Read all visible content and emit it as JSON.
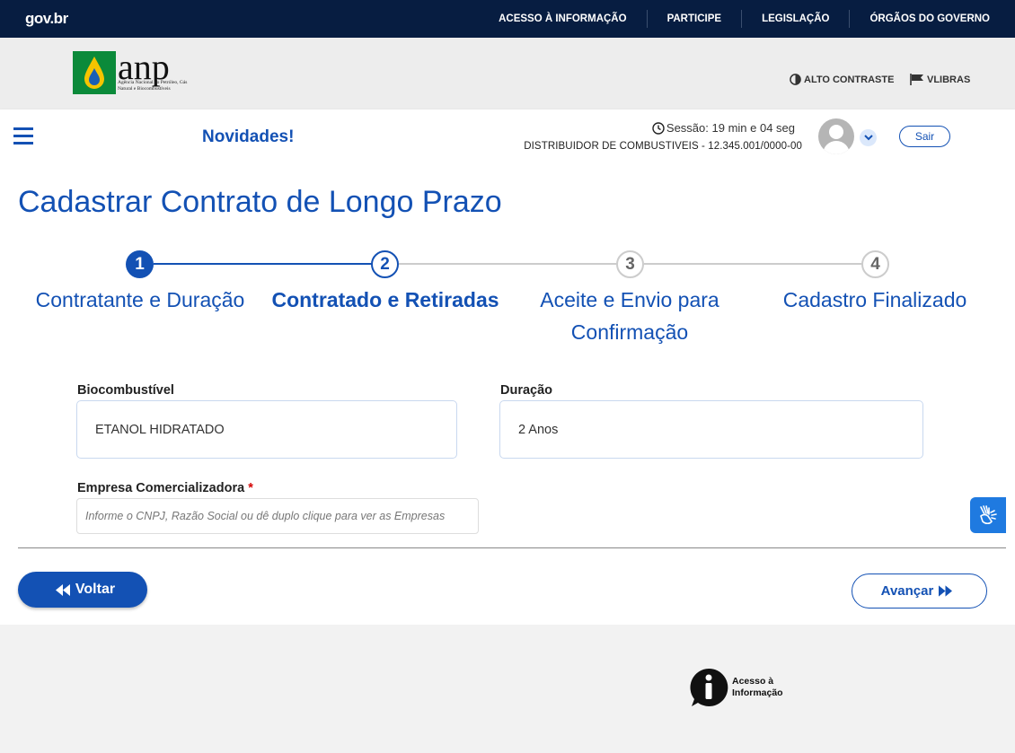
{
  "govbar": {
    "logo": "gov.br",
    "links": [
      "ACESSO À INFORMAÇÃO",
      "PARTICIPE",
      "LEGISLAÇÃO",
      "ÓRGÃOS DO GOVERNO"
    ]
  },
  "header": {
    "logo_word": "anp",
    "logo_sub": "Agência Nacional do Petróleo, Gás Natural e Biocombustíveis",
    "alto_contraste": "ALTO CONTRASTE",
    "vlibras": "VLIBRAS"
  },
  "navbar": {
    "novidades": "Novidades!",
    "sessao": "Sessão: 19 min e 04 seg",
    "distribuidor": "DISTRIBUIDOR DE COMBUSTIVEIS - 12.345.001/0000-00",
    "sair": "Sair"
  },
  "page": {
    "title": "Cadastrar Contrato de Longo Prazo"
  },
  "steps": [
    {
      "number": "1",
      "label": "Contratante e Duração",
      "state": "done"
    },
    {
      "number": "2",
      "label": "Contratado e Retiradas",
      "state": "current"
    },
    {
      "number": "3",
      "label": "Aceite e Envio para Confirmação",
      "state": "pending"
    },
    {
      "number": "4",
      "label": "Cadastro Finalizado",
      "state": "pending"
    }
  ],
  "form": {
    "biocombustivel_label": "Biocombustível",
    "biocombustivel_value": "ETANOL HIDRATADO",
    "duracao_label": "Duração",
    "duracao_value": "2 Anos",
    "empresa_label": "Empresa Comercializadora",
    "empresa_required": "*",
    "empresa_placeholder": "Informe o CNPJ, Razão Social ou dê duplo clique para ver as Empresas"
  },
  "actions": {
    "voltar": "Voltar",
    "avancar": "Avançar"
  },
  "footer": {
    "acesso_line1": "Acesso à",
    "acesso_line2": "Informação"
  },
  "colors": {
    "primary": "#1351b4",
    "govbar": "#071d41",
    "accent_libras": "#1f7ae0"
  }
}
